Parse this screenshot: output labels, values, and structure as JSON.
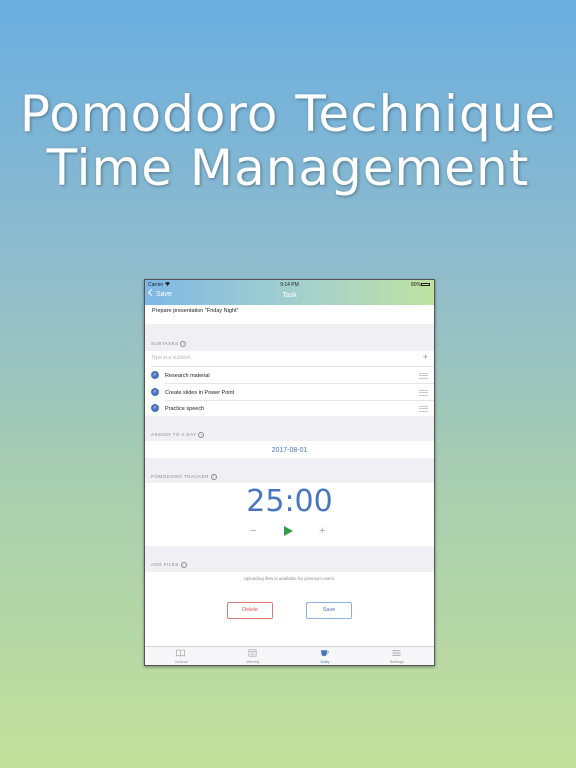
{
  "promo": {
    "line1": "Pomodoro Technique",
    "line2": "Time Management"
  },
  "status_bar": {
    "carrier": "Carrier",
    "time": "9:14 PM",
    "battery": "80%"
  },
  "nav": {
    "back_label": "Save",
    "title": "Task"
  },
  "task": {
    "title": "Prepare presentation \"Friday Night\""
  },
  "subtasks": {
    "section_label": "SUBTASKS",
    "placeholder": "Type in a subtask...",
    "items": [
      {
        "label": "Research material",
        "done": true
      },
      {
        "label": "Create slides in Power Point",
        "done": true
      },
      {
        "label": "Practice speech",
        "done": true
      }
    ]
  },
  "assign": {
    "section_label": "ASSIGN TO A DAY",
    "date": "2017-08-01"
  },
  "pomodoro": {
    "section_label": "POMODORO TRACKER",
    "time": "25:00",
    "minus": "−",
    "plus": "+"
  },
  "files": {
    "section_label": "ADD FILES",
    "note": "Uploading files is available for premium users."
  },
  "actions": {
    "delete_label": "Delete",
    "save_label": "Save"
  },
  "tabs": [
    {
      "label": "Journal",
      "icon": "book-icon",
      "active": false
    },
    {
      "label": "Weekly",
      "icon": "calendar-icon",
      "active": false
    },
    {
      "label": "Daily",
      "icon": "cup-icon",
      "active": true
    },
    {
      "label": "Settings",
      "icon": "menu-icon",
      "active": false
    }
  ],
  "colors": {
    "accent": "#4a76c0",
    "delete": "#d9534f",
    "play": "#2fa04a"
  }
}
